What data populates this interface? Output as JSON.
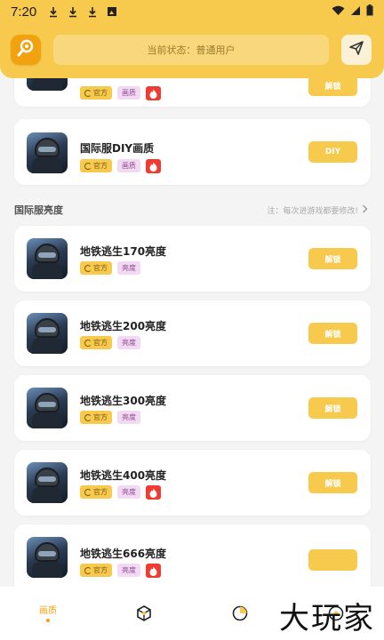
{
  "status_bar": {
    "time": "7:20"
  },
  "header": {
    "current_state": "当前状态：普通用户"
  },
  "top_cards": [
    {
      "title": "",
      "tags": [
        "官方",
        "画质"
      ],
      "hot": true,
      "action": "解锁"
    },
    {
      "title": "国际服DIY画质",
      "tags": [
        "官方",
        "画质"
      ],
      "hot": true,
      "action": "DIY"
    }
  ],
  "section": {
    "title": "国际服亮度",
    "note": "注：每次进游戏都要修改!"
  },
  "items": [
    {
      "title": "地铁逃生170亮度",
      "tags": [
        "官方",
        "亮度"
      ],
      "hot": false,
      "action": "解锁"
    },
    {
      "title": "地铁逃生200亮度",
      "tags": [
        "官方",
        "亮度"
      ],
      "hot": false,
      "action": "解锁"
    },
    {
      "title": "地铁逃生300亮度",
      "tags": [
        "官方",
        "亮度"
      ],
      "hot": false,
      "action": "解锁"
    },
    {
      "title": "地铁逃生400亮度",
      "tags": [
        "官方",
        "亮度"
      ],
      "hot": true,
      "action": "解锁"
    },
    {
      "title": "地铁逃生666亮度",
      "tags": [
        "官方",
        "亮度"
      ],
      "hot": true,
      "action": ""
    }
  ],
  "bottom_nav": {
    "tab1": "画质"
  },
  "watermark": "大玩家",
  "colors": {
    "accent": "#f7c94c",
    "accent_dark": "#f2a20f",
    "hot": "#ef3b32",
    "tag_pink": "#f3d9f3"
  },
  "icons": [
    "download-icon",
    "image-icon",
    "wifi-icon",
    "signal-icon",
    "battery-icon",
    "tool-icon",
    "send-icon",
    "fire-icon",
    "chevron-right-icon",
    "cube-icon",
    "pie-chart-icon"
  ]
}
